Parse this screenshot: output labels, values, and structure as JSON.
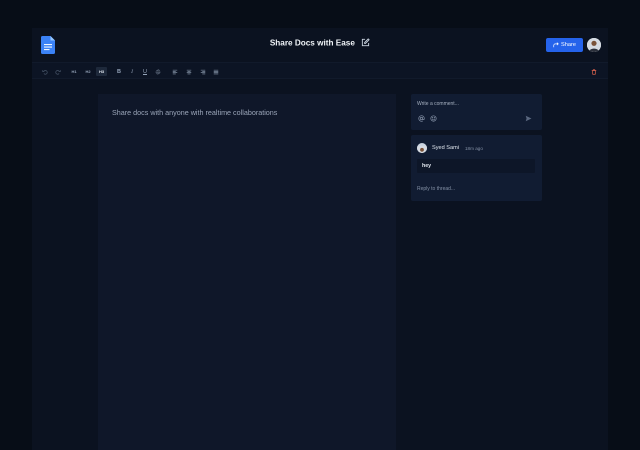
{
  "header": {
    "title": "Share Docs with Ease",
    "share_label": "Share"
  },
  "toolbar": {
    "undo_icon": "undo-icon",
    "redo_icon": "redo-icon",
    "h1": "H1",
    "h2": "H2",
    "h3": "H3",
    "bold": "B",
    "italic": "I",
    "underline": "U",
    "strike_icon": "strikethrough-icon",
    "align_icons": [
      "align-left-icon",
      "align-center-icon",
      "align-right-icon",
      "align-justify-icon"
    ],
    "delete_icon": "trash-icon"
  },
  "editor": {
    "content": "Share docs with anyone with realtime collaborations"
  },
  "comments": {
    "placeholder": "Write a comment...",
    "thread": {
      "user": "Syed Sami",
      "time": "18m ago",
      "message": "hey",
      "reply_label": "Reply to thread..."
    }
  },
  "colors": {
    "background": "#070d17",
    "panel": "#0b1220",
    "editor": "#0f1729",
    "accent": "#2563eb",
    "danger": "#e0654f"
  }
}
